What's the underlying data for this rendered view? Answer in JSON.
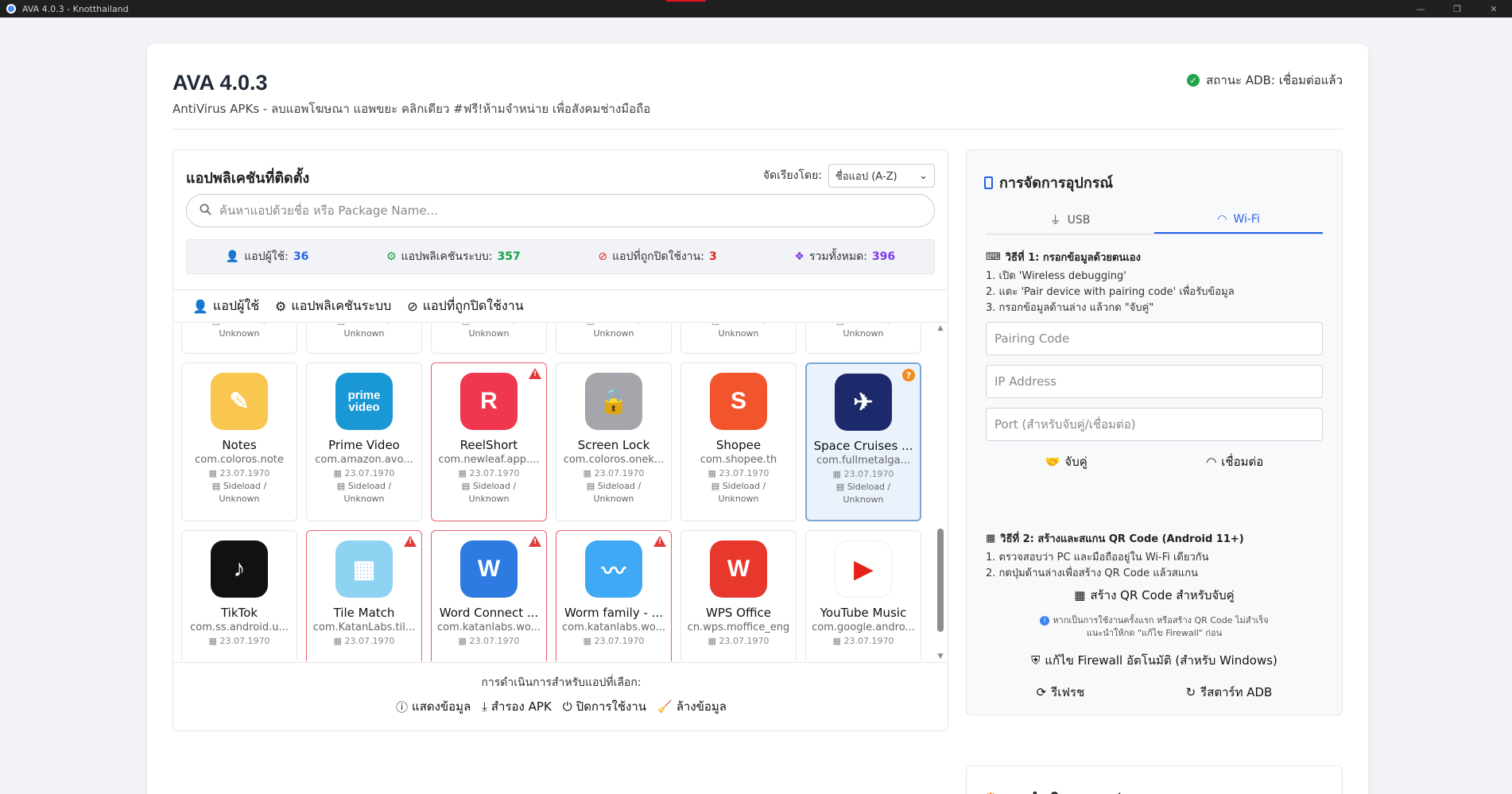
{
  "window": {
    "title": "AVA 4.0.3 - Knotthailand",
    "controls": [
      "—",
      "❐",
      "✕"
    ]
  },
  "header": {
    "title": "AVA 4.0.3",
    "subtitle": "AntiVirus APKs - ลบแอพโฆษณา แอพขยะ คลิกเดียว #ฟรี!ห้ามจำหน่าย เพื่อสังคมช่างมือถือ",
    "adb_status": "สถานะ ADB: เชื่อมต่อแล้ว"
  },
  "apps_panel": {
    "title": "แอปพลิเคชันที่ติดตั้ง",
    "sort_label": "จัดเรียงโดย:",
    "sort_value": "ชื่อแอป (A-Z)",
    "search_placeholder": "ค้นหาแอปด้วยชื่อ หรือ Package Name...",
    "stats": {
      "user_label": "แอปผู้ใช้:",
      "user_count": "36",
      "user_color": "#2563eb",
      "system_label": "แอปพลิเคชันระบบ:",
      "system_count": "357",
      "system_color": "#16a34a",
      "disabled_label": "แอปที่ถูกปิดใช้งาน:",
      "disabled_count": "3",
      "disabled_color": "#dc2626",
      "total_label": "รวมทั้งหมด:",
      "total_count": "396",
      "total_color": "#7c3aed"
    },
    "tabs": [
      "แอปผู้ใช้",
      "แอปพลิเคชันระบบ",
      "แอปที่ถูกปิดใช้งาน"
    ],
    "partial_row_src": [
      "Sideload /",
      "Unknown"
    ],
    "rows": [
      [
        {
          "name": "Notes",
          "pkg": "com.coloros.note",
          "date": "23.07.1970",
          "src1": "Sideload /",
          "src2": "Unknown",
          "icon": "notes-icon",
          "bg": "#f9c74f",
          "glyph": "✎",
          "state": "normal"
        },
        {
          "name": "Prime Video",
          "pkg": "com.amazon.avo...",
          "date": "23.07.1970",
          "src1": "Sideload /",
          "src2": "Unknown",
          "icon": "prime-video-icon",
          "bg": "#1a98d5",
          "glyph": "prime video",
          "state": "normal"
        },
        {
          "name": "ReelShort",
          "pkg": "com.newleaf.app....",
          "date": "23.07.1970",
          "src1": "Sideload /",
          "src2": "Unknown",
          "icon": "reelshort-icon",
          "bg": "#f0374f",
          "glyph": "R",
          "state": "warn"
        },
        {
          "name": "Screen Lock",
          "pkg": "com.coloros.onek...",
          "date": "23.07.1970",
          "src1": "Sideload /",
          "src2": "Unknown",
          "icon": "screen-lock-icon",
          "bg": "#a4a6ab",
          "glyph": "🔒",
          "state": "normal"
        },
        {
          "name": "Shopee",
          "pkg": "com.shopee.th",
          "date": "23.07.1970",
          "src1": "Sideload /",
          "src2": "Unknown",
          "icon": "shopee-icon",
          "bg": "#f2552c",
          "glyph": "S",
          "state": "normal"
        },
        {
          "name": "Space Cruises ...",
          "pkg": "com.fullmetalga...",
          "date": "23.07.1970",
          "src1": "Sideload /",
          "src2": "Unknown",
          "icon": "space-cruises-icon",
          "bg": "#1c2a6b",
          "glyph": "✈",
          "state": "selected"
        }
      ],
      [
        {
          "name": "TikTok",
          "pkg": "com.ss.android.u...",
          "date": "23.07.1970",
          "src1": "",
          "src2": "",
          "icon": "tiktok-icon",
          "bg": "#111111",
          "glyph": "♪",
          "state": "normal"
        },
        {
          "name": "Tile Match",
          "pkg": "com.KatanLabs.til...",
          "date": "23.07.1970",
          "src1": "",
          "src2": "",
          "icon": "tile-match-icon",
          "bg": "#8fd3f2",
          "glyph": "▦",
          "state": "warn"
        },
        {
          "name": "Word Connect ...",
          "pkg": "com.katanlabs.wo...",
          "date": "23.07.1970",
          "src1": "",
          "src2": "",
          "icon": "word-connect-icon",
          "bg": "#2d7be0",
          "glyph": "W",
          "state": "warn"
        },
        {
          "name": "Worm family - ...",
          "pkg": "com.katanlabs.wo...",
          "date": "23.07.1970",
          "src1": "",
          "src2": "",
          "icon": "worm-family-icon",
          "bg": "#3fa9f5",
          "glyph": "〰",
          "state": "warn"
        },
        {
          "name": "WPS Office",
          "pkg": "cn.wps.moffice_eng",
          "date": "23.07.1970",
          "src1": "",
          "src2": "",
          "icon": "wps-office-icon",
          "bg": "#e8382d",
          "glyph": "W",
          "state": "normal"
        },
        {
          "name": "YouTube Music",
          "pkg": "com.google.andro...",
          "date": "23.07.1970",
          "src1": "",
          "src2": "",
          "icon": "youtube-music-icon",
          "bg": "#ffffff",
          "glyph": "▶",
          "state": "normal"
        }
      ]
    ],
    "actions": {
      "title": "การดำเนินการสำหรับแอปที่เลือก:",
      "info": "แสดงข้อมูล",
      "backup": "สำรอง APK",
      "disable": "ปิดการใช้งาน",
      "clear": "ล้างข้อมูล"
    }
  },
  "device_panel": {
    "title": "การจัดการอุปกรณ์",
    "tab_usb": "USB",
    "tab_wifi": "Wi-Fi",
    "method1_title": "วิธีที่ 1: กรอกข้อมูลด้วยตนเอง",
    "method1_steps": [
      "1. เปิด 'Wireless debugging'",
      "2. แตะ 'Pair device with pairing code' เพื่อรับข้อมูล",
      "3. กรอกข้อมูลด้านล่าง แล้วกด \"จับคู่\""
    ],
    "pairing_placeholder": "Pairing Code",
    "ip_placeholder": "IP Address",
    "port_placeholder": "Port (สำหรับจับคู่/เชื่อมต่อ)",
    "pair_label": "จับคู่",
    "connect_label": "เชื่อมต่อ",
    "method2_title": "วิธีที่ 2: สร้างและสแกน QR Code (Android 11+)",
    "method2_steps": [
      "1. ตรวจสอบว่า PC และมือถืออยู่ใน Wi-Fi เดียวกัน",
      "2. กดปุ่มด้านล่างเพื่อสร้าง QR Code แล้วสแกน"
    ],
    "qr_button": "สร้าง QR Code สำหรับจับคู่",
    "hint_line1": "หากเป็นการใช้งานครั้งแรก หรือสร้าง QR Code ไม่สำเร็จ",
    "hint_line2": "แนะนำให้กด \"แก้ไข Firewall\" ก่อน",
    "firewall_button": "แก้ไข Firewall อัตโนมัติ (สำหรับ Windows)",
    "refresh_label": "รีเฟรช",
    "restart_label": "รีสตาร์ท ADB"
  },
  "app_ops_panel": {
    "title": "การดำเนินการแอป"
  }
}
